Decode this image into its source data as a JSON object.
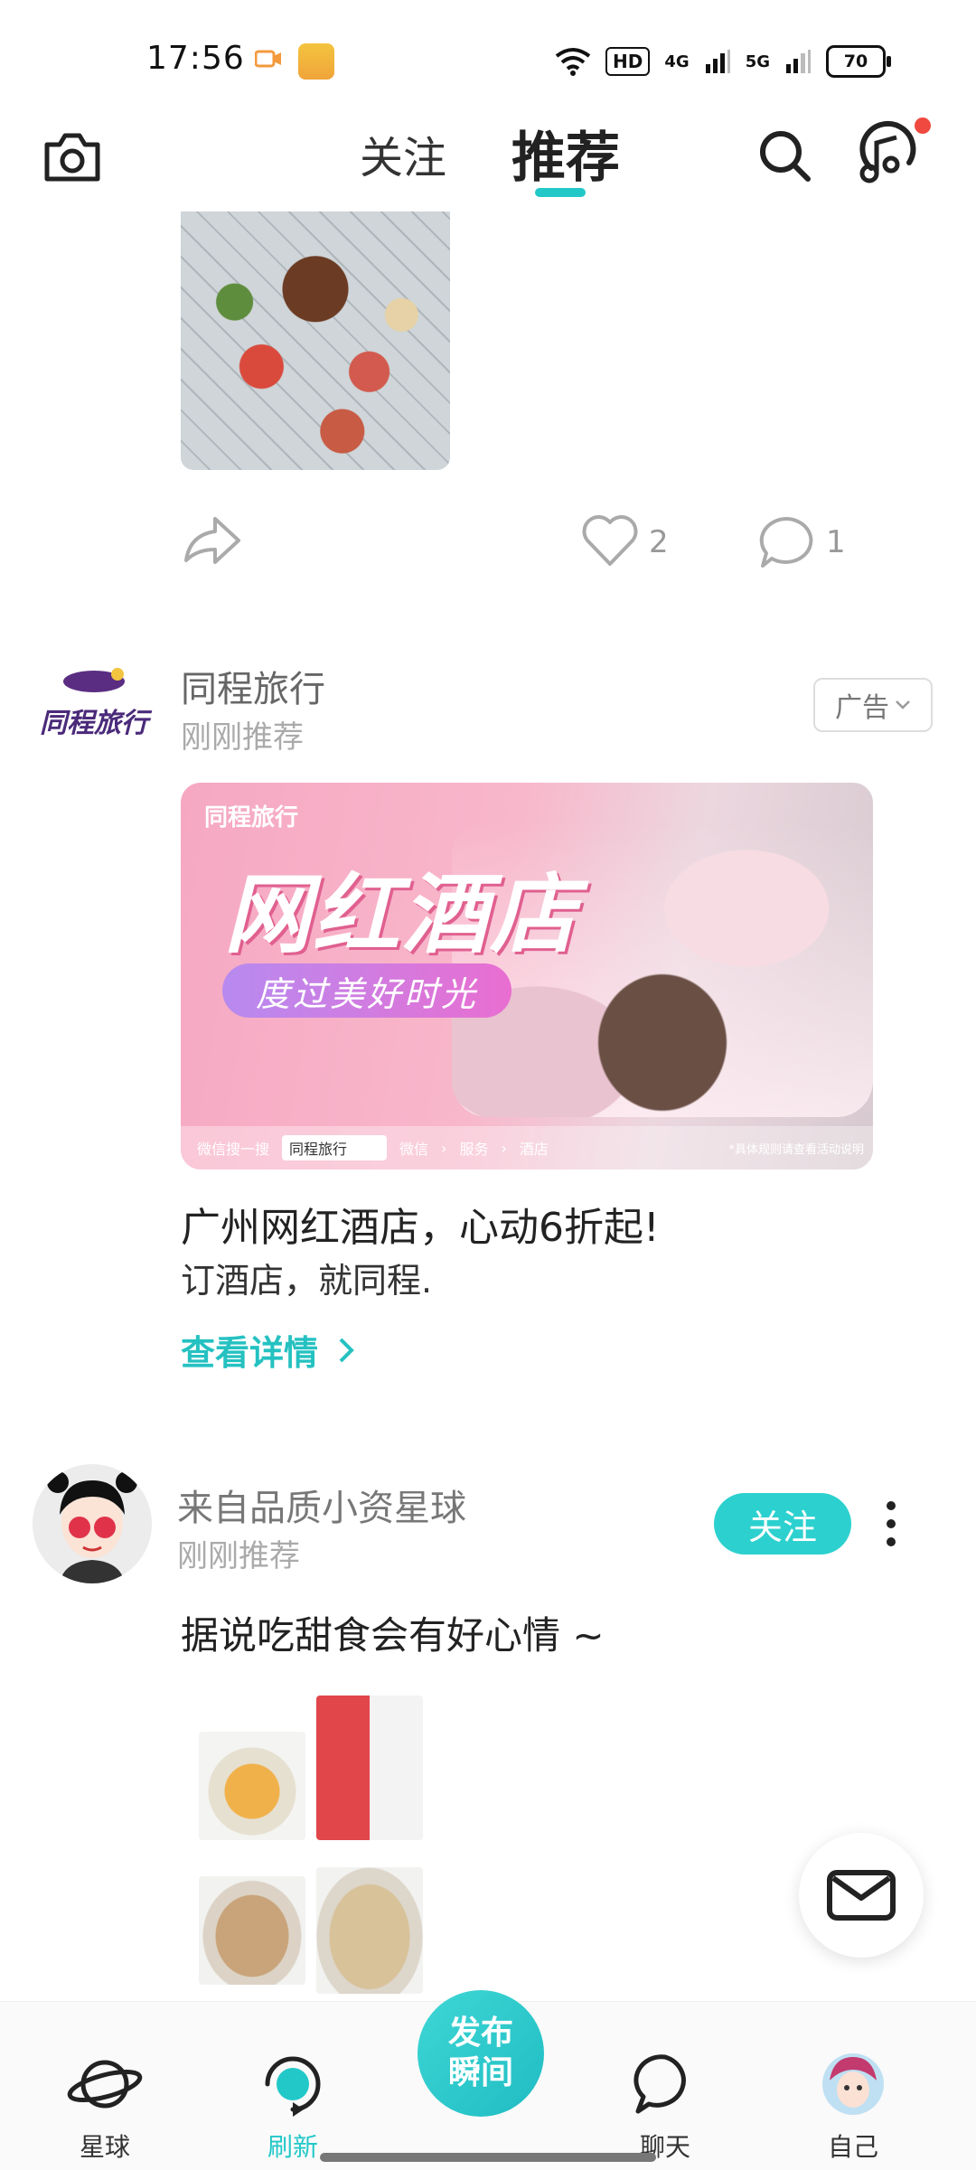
{
  "status_bar": {
    "time": "17:56",
    "hd_label": "HD",
    "net1": "4G",
    "net2": "5G",
    "battery": "70"
  },
  "top_nav": {
    "tab_follow": "关注",
    "tab_recommend": "推荐"
  },
  "post1": {
    "like_count": "2",
    "comment_count": "1"
  },
  "ad": {
    "name": "同程旅行",
    "subtitle": "刚刚推荐",
    "badge": "广告",
    "banner_logo": "同程旅行",
    "banner_title": "网红酒店",
    "banner_pill": "度过美好时光",
    "banner_footer_prefix": "微信搜一搜",
    "banner_search_value": "同程旅行",
    "banner_footer_items": [
      "微信",
      "服务",
      "酒店"
    ],
    "banner_note": "*具体规则请查看活动说明",
    "title": "广州网红酒店，心动6折起!",
    "desc": "订酒店，就同程.",
    "link": "查看详情"
  },
  "post3": {
    "name": "来自品质小资星球",
    "subtitle": "刚刚推荐",
    "follow_label": "关注",
    "text": "据说吃甜食会有好心情 ~"
  },
  "bottom_nav": {
    "items": [
      {
        "label": "星球"
      },
      {
        "label": "刷新"
      },
      {
        "label": "聊天"
      },
      {
        "label": "自己"
      }
    ],
    "publish_line1": "发布",
    "publish_line2": "瞬间"
  },
  "colors": {
    "accent": "#22c8c8",
    "badge_red": "#f0493f"
  }
}
